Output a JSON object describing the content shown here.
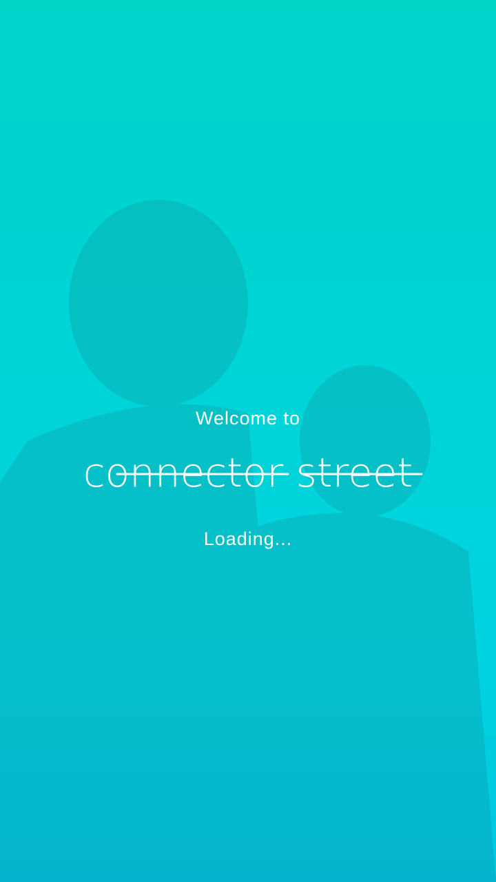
{
  "splash": {
    "welcome_text": "Welcome to",
    "logo_text": "connector street",
    "loading_text": "Loading...",
    "background_colors": [
      "#00d3c8",
      "#00d4d8",
      "#00c6e0"
    ],
    "text_color": "#ffffff"
  }
}
